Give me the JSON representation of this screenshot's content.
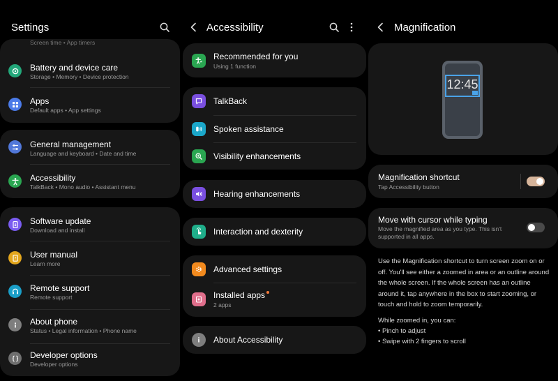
{
  "colors": {
    "background": "#000000",
    "card": "#171717",
    "toggle_on": "#d6b49a",
    "toggle_off": "#4a4a4a",
    "badge": "#f5793a",
    "preview_frame": "#4aa3e8"
  },
  "settings": {
    "title": "Settings",
    "cut_off_text": "Screen time • App timers",
    "items": [
      {
        "label": "Battery and device care",
        "sub": "Storage  •  Memory  •  Device protection",
        "icon": "battery-care-icon",
        "color": "#23a77a"
      },
      {
        "label": "Apps",
        "sub": "Default apps  •  App settings",
        "icon": "apps-grid-icon",
        "color": "#4b7be8"
      },
      {
        "label": "General management",
        "sub": "Language and keyboard  •  Date and time",
        "icon": "sliders-icon",
        "color": "#5178d9"
      },
      {
        "label": "Accessibility",
        "sub": "TalkBack  •  Mono audio  •  Assistant menu",
        "icon": "accessibility-person-icon",
        "color": "#2aa651"
      },
      {
        "label": "Software update",
        "sub": "Download and install",
        "icon": "update-icon",
        "color": "#7a5cf0"
      },
      {
        "label": "User manual",
        "sub": "Learn more",
        "icon": "manual-icon",
        "color": "#e3a61d"
      },
      {
        "label": "Remote support",
        "sub": "Remote support",
        "icon": "headset-icon",
        "color": "#1a9ec7"
      },
      {
        "label": "About phone",
        "sub": "Status  •  Legal information  •  Phone name",
        "icon": "info-icon",
        "color": "#7e7e7e"
      },
      {
        "label": "Developer options",
        "sub": "Developer options",
        "icon": "code-braces-icon",
        "color": "#6f6f6f"
      }
    ]
  },
  "accessibility": {
    "title": "Accessibility",
    "items": [
      {
        "label": "Recommended for you",
        "sub": "Using 1 function",
        "icon": "recommended-icon",
        "color": "#2aa651"
      },
      {
        "label": "TalkBack",
        "sub": "",
        "icon": "talkback-icon",
        "color": "#7a4fe0"
      },
      {
        "label": "Spoken assistance",
        "sub": "",
        "icon": "spoken-icon",
        "color": "#1ba7c9"
      },
      {
        "label": "Visibility enhancements",
        "sub": "",
        "icon": "visibility-icon",
        "color": "#2aa651"
      },
      {
        "label": "Hearing enhancements",
        "sub": "",
        "icon": "hearing-icon",
        "color": "#7a4fe0"
      },
      {
        "label": "Interaction and dexterity",
        "sub": "",
        "icon": "interaction-icon",
        "color": "#1fae8a"
      },
      {
        "label": "Advanced settings",
        "sub": "",
        "icon": "advanced-settings-icon",
        "color": "#f28a1e"
      },
      {
        "label": "Installed apps",
        "sub": "2 apps",
        "icon": "installed-apps-icon",
        "color": "#e06e8b"
      },
      {
        "label": "About Accessibility",
        "sub": "",
        "icon": "info-icon",
        "color": "#7e7e7e"
      }
    ]
  },
  "magnification": {
    "title": "Magnification",
    "preview_time": "12:45",
    "shortcut": {
      "label": "Magnification shortcut",
      "sub": "Tap Accessibility button",
      "enabled": true
    },
    "cursor": {
      "label": "Move with cursor while typing",
      "sub": "Move the magnified area as you type. This isn't supported in all apps.",
      "enabled": false
    },
    "description": "Use the Magnification shortcut to turn screen zoom on or off. You'll see either a zoomed in area or an outline around the whole screen. If the whole screen has an outline around it, tap anywhere in the box to start zooming, or touch and hold to zoom temporarily.",
    "zoom_intro": "While zoomed in, you can:",
    "tips": [
      "• Pinch to adjust",
      "• Swipe with 2 fingers to scroll"
    ]
  }
}
